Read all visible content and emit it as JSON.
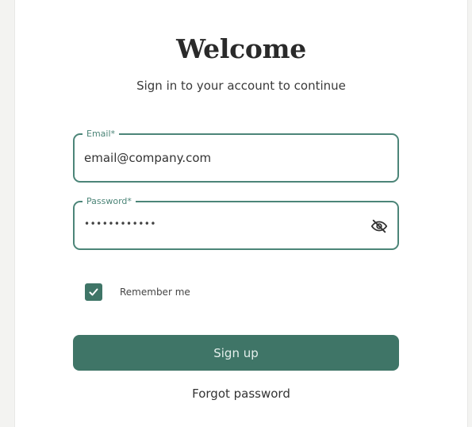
{
  "header": {
    "title": "Welcome",
    "subtitle": "Sign in to your account to continue"
  },
  "form": {
    "email": {
      "label": "Email*",
      "value": "email@company.com",
      "icon": null
    },
    "password": {
      "label": "Password*",
      "value": "••••••••••••",
      "toggle_icon": "eye-slash-icon"
    },
    "remember": {
      "label": "Remember me",
      "checked": true,
      "icon": "checkmark-icon"
    },
    "submit_label": "Sign up",
    "forgot_label": "Forgot password"
  },
  "colors": {
    "accent": "#3f7567",
    "field_border": "#4c8578",
    "background": "#ffffff"
  }
}
